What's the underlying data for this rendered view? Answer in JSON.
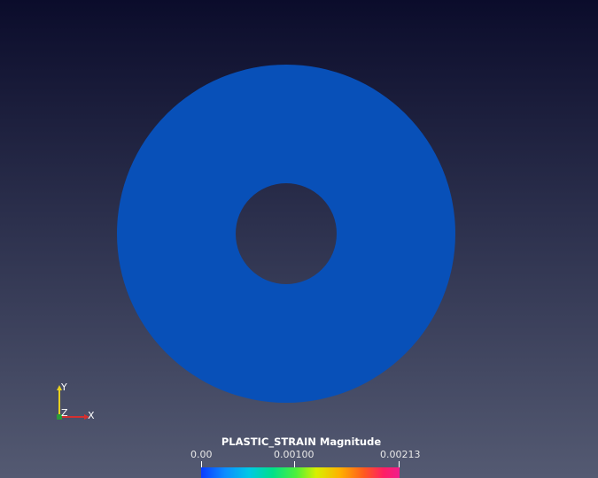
{
  "scene": {
    "background_top": "#0b0c2b",
    "background_bottom": "#545a72",
    "annulus_color": "#0850b8",
    "hole_color": "#2a2e4b"
  },
  "axes": {
    "x_label": "X",
    "y_label": "Y",
    "z_label": "Z",
    "x_color": "#d43030",
    "y_color": "#e8d020",
    "z_color": "#2a9a3a"
  },
  "colorbar": {
    "title": "PLASTIC_STRAIN Magnitude",
    "ticks": [
      "0.00",
      "0.00100",
      "0.00213"
    ],
    "colormap": "rainbow"
  }
}
